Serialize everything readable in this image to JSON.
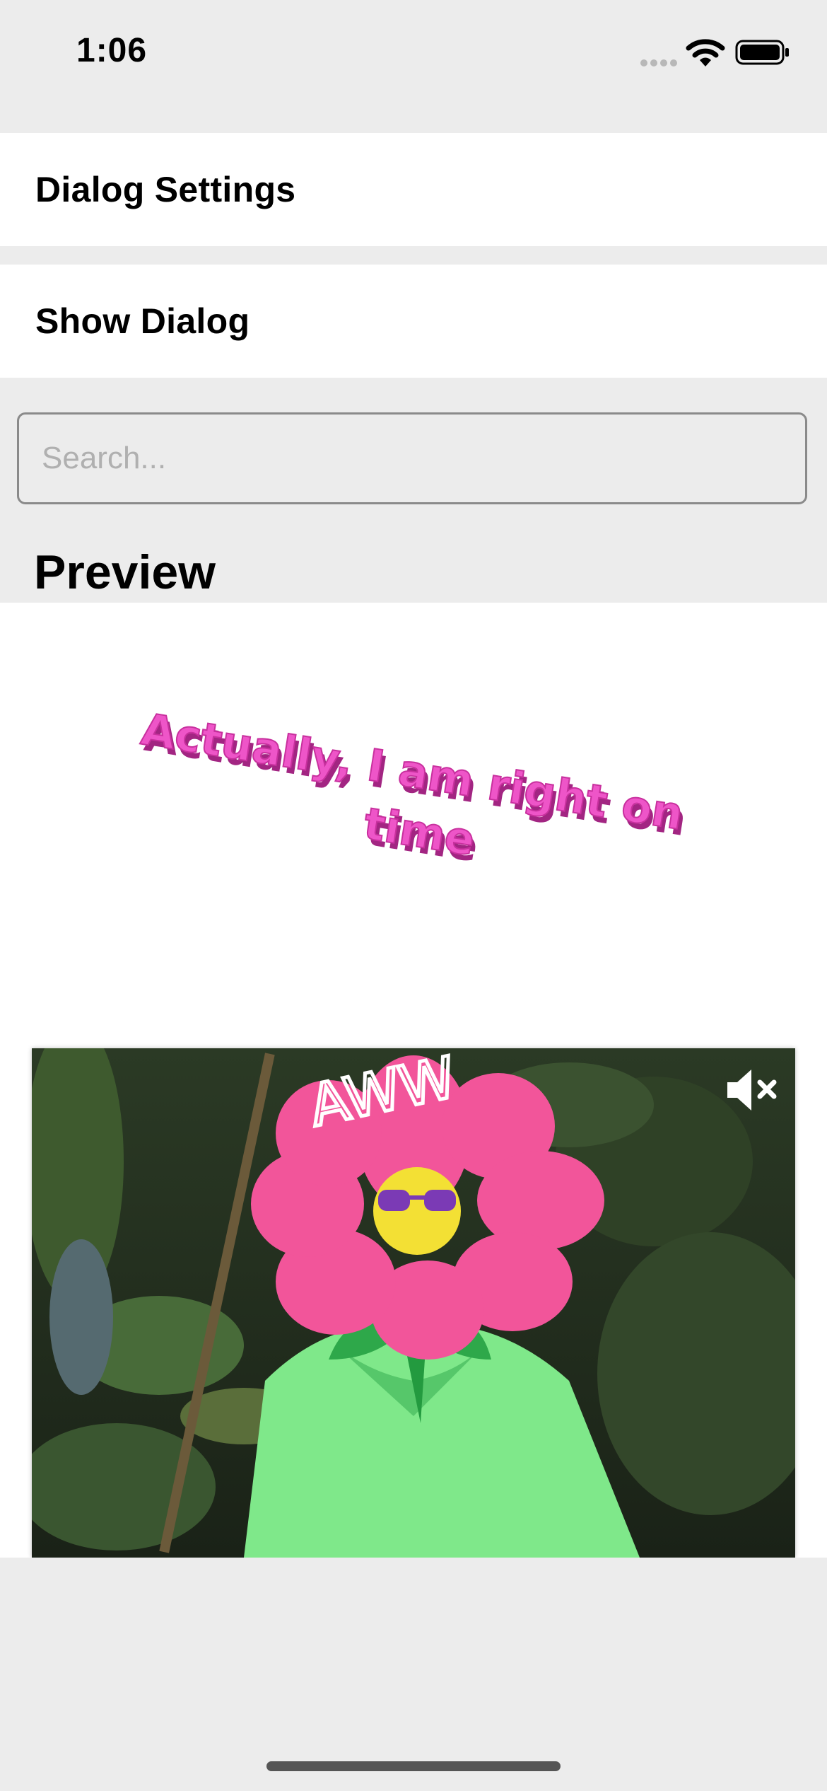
{
  "status_bar": {
    "time": "1:06"
  },
  "menu": {
    "dialog_settings_label": "Dialog Settings",
    "show_dialog_label": "Show Dialog"
  },
  "search": {
    "placeholder": "Search...",
    "value": ""
  },
  "preview": {
    "title": "Preview",
    "sticker_text_line1": "Actually, I am right on",
    "sticker_text_line2": "time",
    "video_caption": "AWW",
    "video_muted": true
  },
  "icons": {
    "wifi": "wifi-icon",
    "battery": "battery-icon",
    "mute": "speaker-mute-icon"
  },
  "colors": {
    "background": "#ececec",
    "row_background": "#ffffff",
    "sticker_pink": "#e94fc0",
    "flower_pink": "#f2559a",
    "shirt_green": "#7fe88a"
  }
}
